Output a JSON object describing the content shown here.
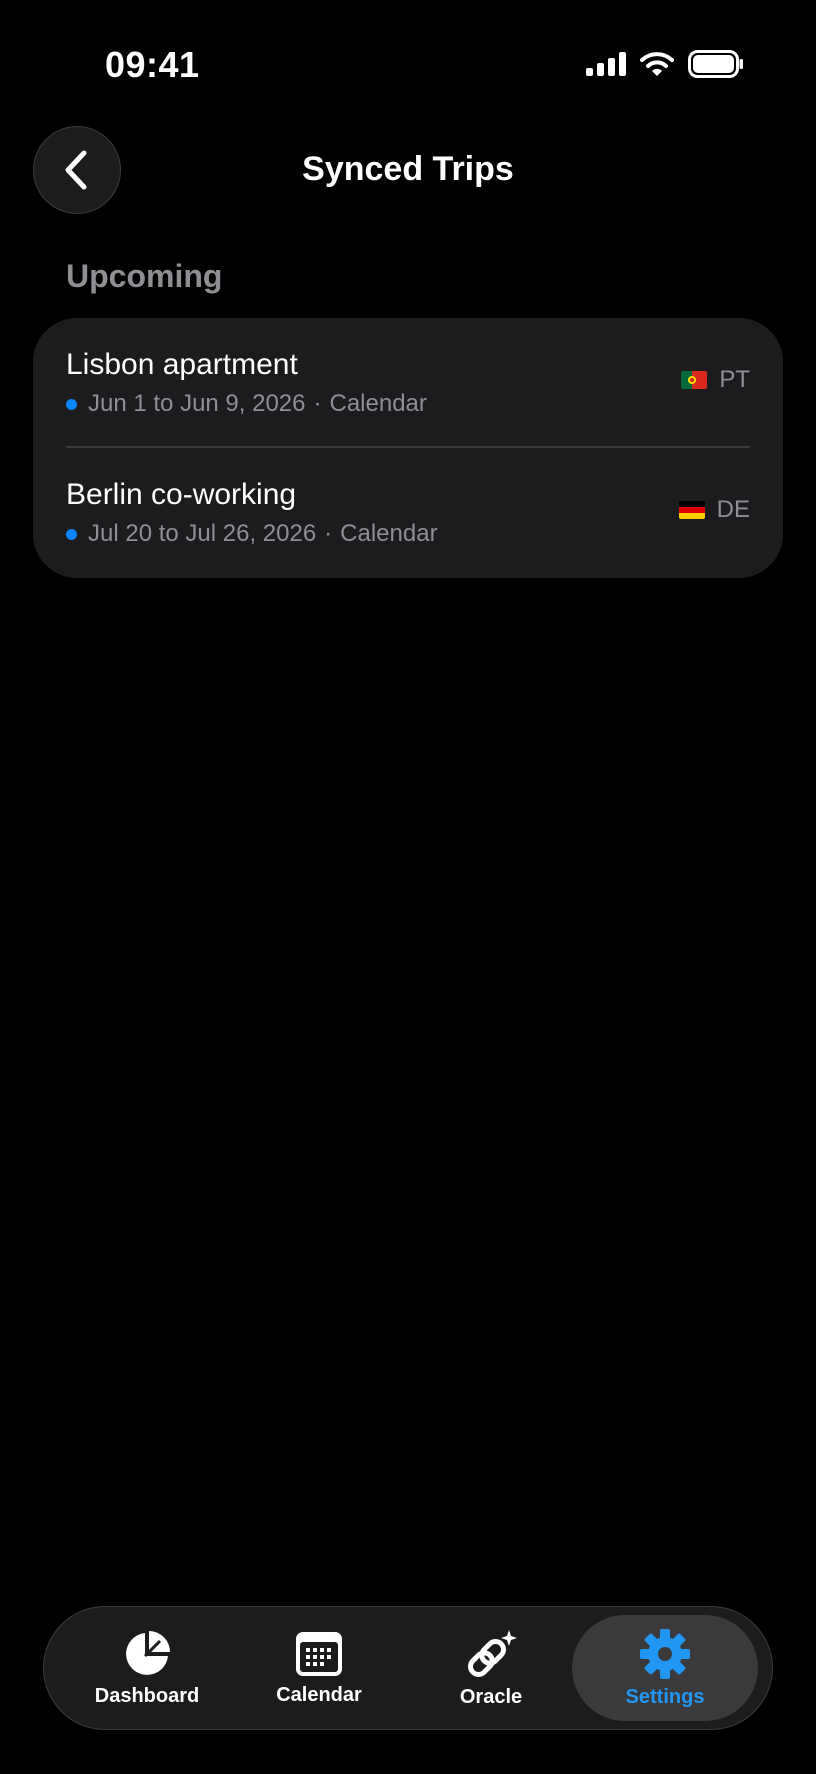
{
  "status_bar": {
    "time": "09:41",
    "icons": [
      "cellular-signal-icon",
      "wifi-icon",
      "battery-icon"
    ]
  },
  "header": {
    "back_icon": "chevron-left-icon",
    "title": "Synced Trips"
  },
  "section": {
    "title": "Upcoming"
  },
  "trips": [
    {
      "name": "Lisbon apartment",
      "dates": "Jun 1 to Jun 9, 2026",
      "separator": "·",
      "source": "Calendar",
      "country_code": "PT",
      "flag_icon": "portugal-flag-icon"
    },
    {
      "name": "Berlin co-working",
      "dates": "Jul 20 to Jul 26, 2026",
      "separator": "·",
      "source": "Calendar",
      "country_code": "DE",
      "flag_icon": "germany-flag-icon"
    }
  ],
  "tab_bar": {
    "tabs": [
      {
        "label": "Dashboard",
        "icon": "pie-chart-icon",
        "active": false
      },
      {
        "label": "Calendar",
        "icon": "calendar-icon",
        "active": false
      },
      {
        "label": "Oracle",
        "icon": "sparkle-link-icon",
        "active": false
      },
      {
        "label": "Settings",
        "icon": "gear-icon",
        "active": true
      }
    ]
  },
  "colors": {
    "background": "#000000",
    "card": "#1c1c1e",
    "accent": "#2196f3",
    "dot": "#0a84ff",
    "secondary_text": "#8e8e93"
  }
}
